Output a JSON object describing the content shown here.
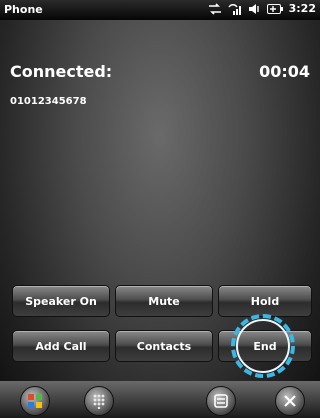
{
  "statusbar": {
    "title": "Phone",
    "time": "3:22"
  },
  "call": {
    "state": "Connected:",
    "timer": "00:04",
    "number": "01012345678"
  },
  "buttons": {
    "speaker": "Speaker On",
    "mute": "Mute",
    "hold": "Hold",
    "add_call": "Add Call",
    "contacts": "Contacts",
    "end": "End"
  },
  "bottombar": {
    "icons": [
      "windows-start-icon",
      "keypad-icon",
      "menu-icon",
      "close-icon"
    ]
  }
}
